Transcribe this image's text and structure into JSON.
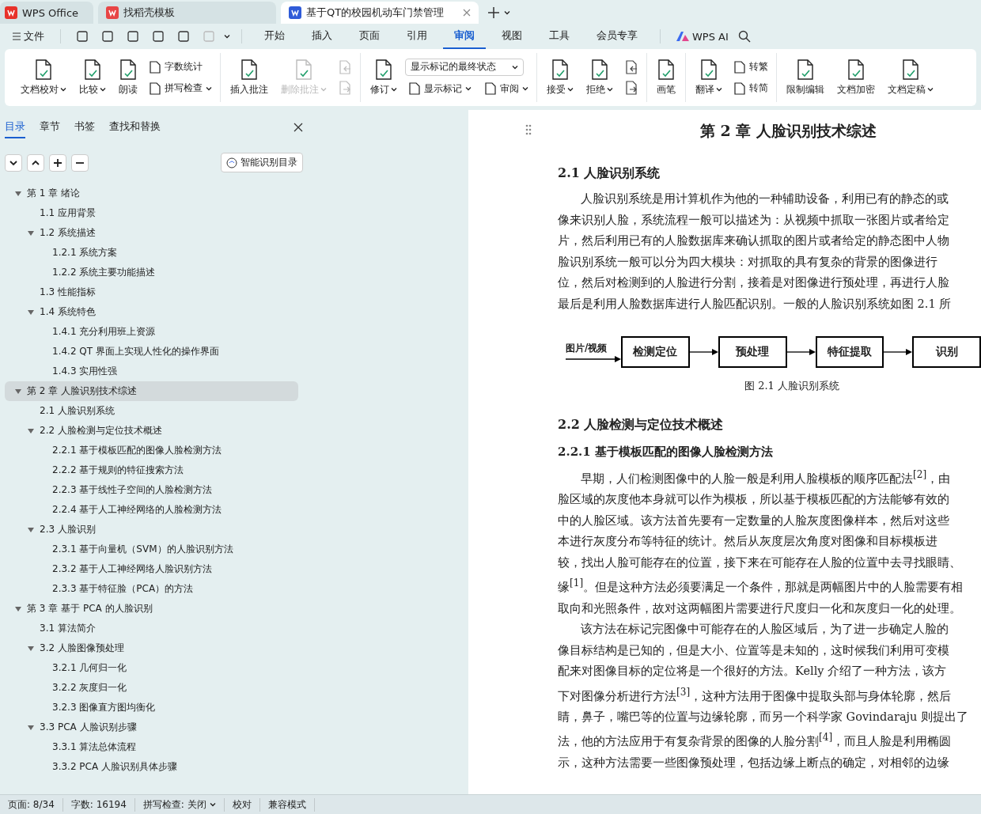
{
  "browser_tabs": [
    {
      "label": "WPS Office",
      "selected": false
    },
    {
      "label": "找稻壳模板",
      "selected": false
    },
    {
      "label": "基于QT的校园机动车门禁管理",
      "selected": true
    }
  ],
  "menu": {
    "file": "文件",
    "tabs": [
      {
        "label": "开始",
        "selected": false
      },
      {
        "label": "插入",
        "selected": false
      },
      {
        "label": "页面",
        "selected": false
      },
      {
        "label": "引用",
        "selected": false
      },
      {
        "label": "审阅",
        "selected": true
      },
      {
        "label": "视图",
        "selected": false
      },
      {
        "label": "工具",
        "selected": false
      },
      {
        "label": "会员专享",
        "selected": false
      }
    ],
    "ai": "WPS AI"
  },
  "ribbon": [
    {
      "items": [
        {
          "kind": "large",
          "label": "文档校对",
          "dropdown": true,
          "disabled": false
        },
        {
          "kind": "large",
          "label": "比较",
          "dropdown": true,
          "disabled": false
        },
        {
          "kind": "large",
          "label": "朗读",
          "dropdown": false,
          "disabled": false
        },
        {
          "kind": "stack",
          "rows": [
            {
              "label": "字数统计",
              "dropdown": false,
              "disabled": false
            },
            {
              "label": "拼写检查",
              "dropdown": true,
              "disabled": false
            }
          ]
        }
      ]
    },
    {
      "items": [
        {
          "kind": "large",
          "label": "插入批注",
          "dropdown": false,
          "disabled": false
        },
        {
          "kind": "large",
          "label": "删除批注",
          "dropdown": true,
          "disabled": true
        },
        {
          "kind": "icons",
          "disabled": true
        }
      ]
    },
    {
      "items": [
        {
          "kind": "large",
          "label": "修订",
          "dropdown": true,
          "disabled": false
        },
        {
          "kind": "select",
          "value": "显示标记的最终状态",
          "rows": [
            {
              "label": "显示标记",
              "dropdown": true,
              "disabled": false
            },
            {
              "label": "审阅",
              "dropdown": true,
              "disabled": false
            }
          ]
        }
      ]
    },
    {
      "items": [
        {
          "kind": "large",
          "label": "接受",
          "dropdown": true,
          "disabled": false
        },
        {
          "kind": "large",
          "label": "拒绝",
          "dropdown": true,
          "disabled": false
        },
        {
          "kind": "icons",
          "disabled": false
        }
      ]
    },
    {
      "items": [
        {
          "kind": "large",
          "label": "画笔",
          "dropdown": false,
          "disabled": false
        }
      ]
    },
    {
      "items": [
        {
          "kind": "large",
          "label": "翻译",
          "dropdown": true,
          "disabled": false
        },
        {
          "kind": "stack",
          "rows": [
            {
              "label": "转繁",
              "dropdown": false,
              "disabled": false
            },
            {
              "label": "转简",
              "dropdown": false,
              "disabled": false
            }
          ]
        }
      ]
    },
    {
      "items": [
        {
          "kind": "large",
          "label": "限制编辑",
          "dropdown": false,
          "disabled": false
        },
        {
          "kind": "large",
          "label": "文档加密",
          "dropdown": false,
          "disabled": false
        },
        {
          "kind": "large",
          "label": "文档定稿",
          "dropdown": true,
          "disabled": false
        }
      ]
    }
  ],
  "sidebar": {
    "tabs": [
      {
        "label": "目录",
        "selected": true
      },
      {
        "label": "章节",
        "selected": false
      },
      {
        "label": "书签",
        "selected": false
      },
      {
        "label": "查找和替换",
        "selected": false
      }
    ],
    "smart_button": "智能识别目录",
    "outline": [
      {
        "label": "第 1 章  绪论",
        "selected": false,
        "expanded": true,
        "children": [
          {
            "label": "1.1  应用背景",
            "selected": false
          },
          {
            "label": "1.2  系统描述",
            "selected": false,
            "expanded": true,
            "children": [
              {
                "label": "1.2.1  系统方案",
                "selected": false
              },
              {
                "label": "1.2.2  系统主要功能描述",
                "selected": false
              }
            ]
          },
          {
            "label": "1.3  性能指标",
            "selected": false
          },
          {
            "label": "1.4  系统特色",
            "selected": false,
            "expanded": true,
            "children": [
              {
                "label": "1.4.1  充分利用班上资源",
                "selected": false
              },
              {
                "label": "1.4.2 QT 界面上实现人性化的操作界面",
                "selected": false
              },
              {
                "label": "1.4.3  实用性强",
                "selected": false
              }
            ]
          }
        ]
      },
      {
        "label": "第 2 章  人脸识别技术综述",
        "selected": true,
        "expanded": true,
        "children": [
          {
            "label": "2.1  人脸识别系统",
            "selected": false
          },
          {
            "label": "2.2  人脸检测与定位技术概述",
            "selected": false,
            "expanded": true,
            "children": [
              {
                "label": "2.2.1  基于模板匹配的图像人脸检测方法",
                "selected": false
              },
              {
                "label": "2.2.2  基于规则的特征搜索方法",
                "selected": false
              },
              {
                "label": "2.2.3  基于线性子空间的人脸检测方法",
                "selected": false
              },
              {
                "label": "2.2.4  基于人工神经网络的人脸检测方法",
                "selected": false
              }
            ]
          },
          {
            "label": "2.3  人脸识别",
            "selected": false,
            "expanded": true,
            "children": [
              {
                "label": "2.3.1  基于向量机（SVM）的人脸识别方法",
                "selected": false
              },
              {
                "label": "2.3.2  基于人工神经网络人脸识别方法",
                "selected": false
              },
              {
                "label": "2.3.3  基于特征脸（PCA）的方法",
                "selected": false
              }
            ]
          }
        ]
      },
      {
        "label": "第 3 章  基于 PCA 的人脸识别",
        "selected": false,
        "expanded": true,
        "children": [
          {
            "label": "3.1  算法简介",
            "selected": false
          },
          {
            "label": "3.2  人脸图像预处理",
            "selected": false,
            "expanded": true,
            "children": [
              {
                "label": "3.2.1  几何归一化",
                "selected": false
              },
              {
                "label": "3.2.2  灰度归一化",
                "selected": false
              },
              {
                "label": "3.2.3  图像直方图均衡化",
                "selected": false
              }
            ]
          },
          {
            "label": "3.3 PCA 人脸识别步骤",
            "selected": false,
            "expanded": true,
            "children": [
              {
                "label": "3.3.1  算法总体流程",
                "selected": false
              },
              {
                "label": "3.3.2 PCA 人脸识别具体步骤",
                "selected": false
              }
            ]
          }
        ]
      }
    ]
  },
  "document": {
    "chapter_title": "第 2 章  人脸识别技术综述",
    "blocks": [
      {
        "kind": "h2",
        "text": "2.1  人脸识别系统"
      },
      {
        "kind": "para",
        "lines": [
          "人脸识别系统是用计算机作为他的一种辅助设备，利用已有的静态的或",
          "像来识别人脸，系统流程一般可以描述为：从视频中抓取一张图片或者给定",
          "片，然后利用已有的人脸数据库来确认抓取的图片或者给定的静态图中人物",
          "脸识别系统一般可以分为四大模块：对抓取的具有复杂的背景的图像进行",
          "位，然后对检测到的人脸进行分割，接着是对图像进行预处理，再进行人脸",
          "最后是利用人脸数据库进行人脸匹配识别。一般的人脸识别系统如图 2.1 所"
        ]
      },
      {
        "kind": "figure",
        "input": "图片/视频",
        "steps": [
          "检测定位",
          "预处理",
          "特征提取",
          "识别"
        ],
        "caption": "图 2.1  人脸识别系统"
      },
      {
        "kind": "h2",
        "text": "2.2  人脸检测与定位技术概述"
      },
      {
        "kind": "h3",
        "text": "2.2.1  基于模板匹配的图像人脸检测方法"
      },
      {
        "kind": "para",
        "lines": [
          "早期，人们检测图像中的人脸一般是利用人脸模板的顺序匹配法$^{[2]}$，由",
          "脸区域的灰度他本身就可以作为模板，所以基于模板匹配的方法能够有效的",
          "中的人脸区域。该方法首先要有一定数量的人脸灰度图像样本，然后对这些",
          "本进行灰度分布等特征的统计。然后从灰度层次角度对图像和目标模板进",
          "较，找出人脸可能存在的位置，接下来在可能存在人脸的位置中去寻找眼睛、",
          "缘$^{[1]}$。但是这种方法必须要满足一个条件，那就是两幅图片中的人脸需要有相",
          "取向和光照条件，故对这两幅图片需要进行尺度归一化和灰度归一化的处理。"
        ]
      },
      {
        "kind": "para",
        "lines": [
          "该方法在标记完图像中可能存在的人脸区域后，为了进一步确定人脸的",
          "像目标结构是已知的，但是大小、位置等是未知的，这时候我们利用可变模",
          "配来对图像目标的定位将是一个很好的方法。Kelly 介绍了一种方法，该方",
          "下对图像分析进行方法$^{[3]}$，这种方法用于图像中提取头部与身体轮廓，然后",
          "睛，鼻子，嘴巴等的位置与边缘轮廓，而另一个科学家 Govindaraju 则提出了",
          "法，他的方法应用于有复杂背景的图像的人脸分割$^{[4]}$，而且人脸是利用椭圆",
          "示，这种方法需要一些图像预处理，包括边缘上断点的确定，对相邻的边缘"
        ]
      }
    ]
  },
  "status_bar": [
    {
      "label": "页面: 8/34",
      "dropdown": false
    },
    {
      "label": "字数: 16194",
      "dropdown": false
    },
    {
      "label": "拼写检查: 关闭",
      "dropdown": true
    },
    {
      "label": "校对",
      "dropdown": false
    },
    {
      "label": "兼容模式",
      "dropdown": false
    }
  ]
}
